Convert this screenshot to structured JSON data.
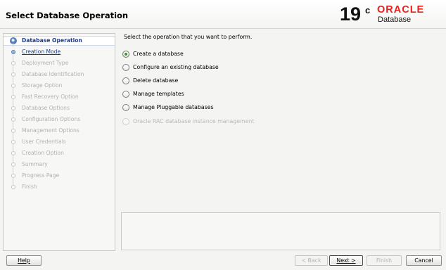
{
  "header": {
    "title": "Select Database Operation",
    "version_number": "19",
    "version_suffix": "c",
    "brand": "ORACLE",
    "product": "Database",
    "brand_color": "#e8211d"
  },
  "nav": {
    "steps": [
      {
        "label": "Database Operation",
        "state": "current"
      },
      {
        "label": "Creation Mode",
        "state": "linked"
      },
      {
        "label": "Deployment Type",
        "state": "disabled"
      },
      {
        "label": "Database Identification",
        "state": "disabled"
      },
      {
        "label": "Storage Option",
        "state": "disabled"
      },
      {
        "label": "Fast Recovery Option",
        "state": "disabled"
      },
      {
        "label": "Database Options",
        "state": "disabled"
      },
      {
        "label": "Configuration Options",
        "state": "disabled"
      },
      {
        "label": "Management Options",
        "state": "disabled"
      },
      {
        "label": "User Credentials",
        "state": "disabled"
      },
      {
        "label": "Creation Option",
        "state": "disabled"
      },
      {
        "label": "Summary",
        "state": "disabled"
      },
      {
        "label": "Progress Page",
        "state": "disabled"
      },
      {
        "label": "Finish",
        "state": "disabled"
      }
    ]
  },
  "content": {
    "prompt": "Select the operation that you want to perform.",
    "options": [
      {
        "label": "Create a database",
        "selected": true,
        "enabled": true
      },
      {
        "label": "Configure an existing database",
        "selected": false,
        "enabled": true
      },
      {
        "label": "Delete database",
        "selected": false,
        "enabled": true
      },
      {
        "label": "Manage templates",
        "selected": false,
        "enabled": true
      },
      {
        "label": "Manage Pluggable databases",
        "selected": false,
        "enabled": true
      },
      {
        "label": "Oracle RAC database instance management",
        "selected": false,
        "enabled": false
      }
    ]
  },
  "footer": {
    "help": "Help",
    "back": "< Back",
    "next": "Next >",
    "finish": "Finish",
    "cancel": "Cancel"
  }
}
